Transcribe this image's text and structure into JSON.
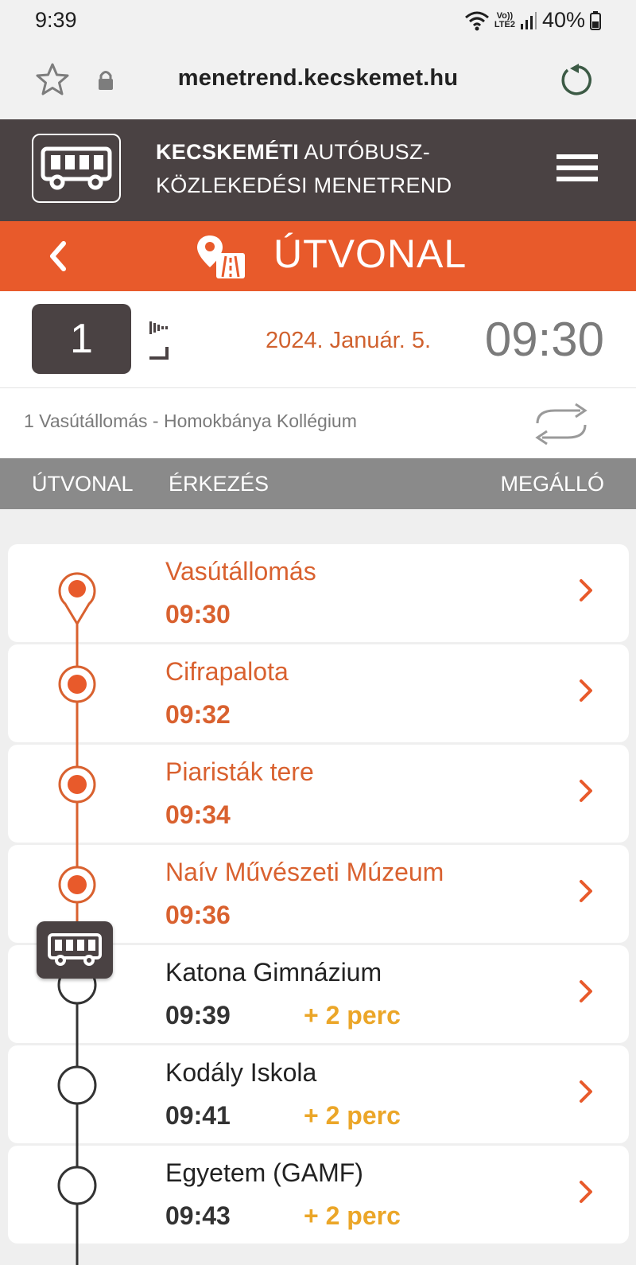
{
  "status": {
    "time": "9:39",
    "net_top": "Vo))",
    "net_bottom": "LTE2",
    "battery": "40%"
  },
  "browser": {
    "url": "menetrend.kecskemet.hu"
  },
  "header": {
    "title_bold": "KECSKEMÉTI",
    "title_rest1": " AUTÓBUSZ-",
    "title_line2": "KÖZLEKEDÉSI MENETREND"
  },
  "section": {
    "title": "ÚTVONAL"
  },
  "line": {
    "number": "1",
    "date": "2024. Január. 5.",
    "time": "09:30",
    "route": "1 Vasútállomás - Homokbánya Kollégium"
  },
  "tabs": {
    "route": "ÚTVONAL",
    "arrival": "ÉRKEZÉS",
    "stop": "MEGÁLLÓ"
  },
  "stops": [
    {
      "name": "Vasútállomás",
      "time": "09:30",
      "delay": "",
      "state": "passed"
    },
    {
      "name": "Cifrapalota",
      "time": "09:32",
      "delay": "",
      "state": "passed"
    },
    {
      "name": "Piaristák tere",
      "time": "09:34",
      "delay": "",
      "state": "passed"
    },
    {
      "name": "Naív Művészeti Múzeum",
      "time": "09:36",
      "delay": "",
      "state": "passed"
    },
    {
      "name": "Katona Gimnázium",
      "time": "09:39",
      "delay": "+ 2 perc",
      "state": "future"
    },
    {
      "name": "Kodály Iskola",
      "time": "09:41",
      "delay": "+ 2 perc",
      "state": "future"
    },
    {
      "name": "Egyetem (GAMF)",
      "time": "09:43",
      "delay": "+ 2 perc",
      "state": "future"
    }
  ],
  "colors": {
    "accent": "#e85a2b",
    "dark": "#4a4243",
    "passed": "#d9612f",
    "delay": "#eba628"
  }
}
